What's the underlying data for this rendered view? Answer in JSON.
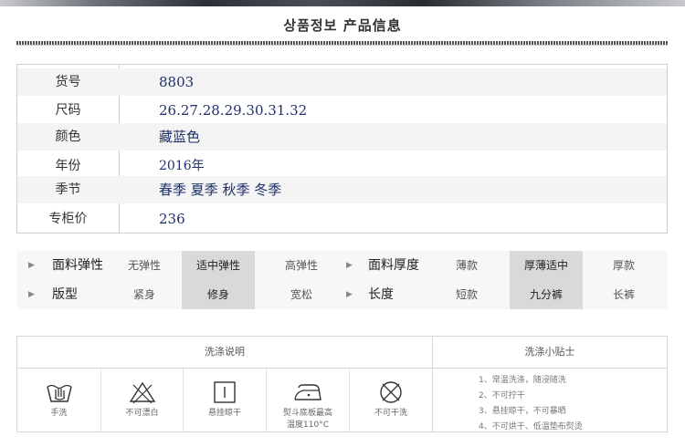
{
  "header": {
    "title": "상품정보   产品信息"
  },
  "product_info": [
    {
      "key": "货号",
      "value": "8803"
    },
    {
      "key": "尺码",
      "value": "26.27.28.29.30.31.32"
    },
    {
      "key": "颜色",
      "value": "藏蓝色"
    },
    {
      "key": "年份",
      "value": "2016年"
    },
    {
      "key": "季节",
      "value": "春季 夏季 秋季 冬季"
    },
    {
      "key": "专柜价",
      "value": "236"
    }
  ],
  "attributes": {
    "row1": {
      "left": {
        "label": "面料弹性",
        "options": [
          "无弹性",
          "适中弹性",
          "高弹性"
        ],
        "selected": "适中弹性"
      },
      "right": {
        "label": "面料厚度",
        "options": [
          "薄款",
          "厚薄适中",
          "厚款"
        ],
        "selected": "厚薄适中"
      }
    },
    "row2": {
      "left": {
        "label": "版型",
        "options": [
          "紧身",
          "修身",
          "宽松"
        ],
        "selected": "修身"
      },
      "right": {
        "label": "长度",
        "options": [
          "短款",
          "九分裤",
          "长裤"
        ],
        "selected": "九分裤"
      }
    }
  },
  "washing": {
    "instructions_title": "洗涤说明",
    "tips_title": "洗涤小贴士",
    "icons": [
      {
        "icon": "hand-wash-icon",
        "caption": "手洗"
      },
      {
        "icon": "no-bleach-icon",
        "caption": "不可漂白"
      },
      {
        "icon": "hang-dry-icon",
        "caption": "悬挂晾干"
      },
      {
        "icon": "iron-icon",
        "caption1": "熨斗底板最高",
        "caption2": "温度110°C"
      },
      {
        "icon": "no-dryclean-icon",
        "caption": "不可干洗"
      }
    ],
    "tips": [
      "1、常温洗涤，随浸随洗",
      "2、不可拧干",
      "3、悬挂晾干，不可暴晒",
      "4、不可烘干、低温垫布熨烫"
    ]
  },
  "colors": {
    "value_text": "#1f2f6a",
    "selected_option": "#d9d9d9",
    "table_border": "#cfcfcf"
  }
}
